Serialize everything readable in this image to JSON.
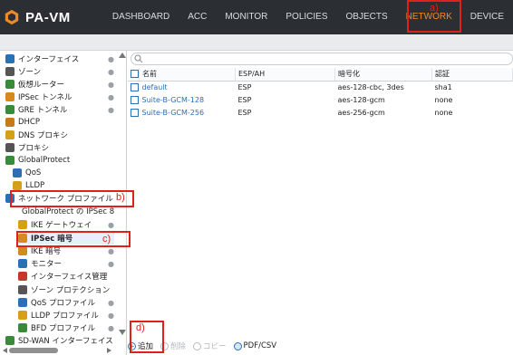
{
  "app": {
    "title": "PA-VM"
  },
  "nav": [
    {
      "label": "DASHBOARD",
      "active": false
    },
    {
      "label": "ACC",
      "active": false
    },
    {
      "label": "MONITOR",
      "active": false
    },
    {
      "label": "POLICIES",
      "active": false
    },
    {
      "label": "OBJECTS",
      "active": false
    },
    {
      "label": "NETWORK",
      "active": true
    },
    {
      "label": "DEVICE",
      "active": false
    }
  ],
  "sidebar": {
    "items": [
      {
        "label": "インターフェイス",
        "icon": "interface-icon"
      },
      {
        "label": "ゾーン",
        "icon": "zone-icon"
      },
      {
        "label": "仮想ルーター",
        "icon": "router-icon"
      },
      {
        "label": "IPSec トンネル",
        "icon": "tunnel-icon"
      },
      {
        "label": "GRE トンネル",
        "icon": "gre-icon"
      },
      {
        "label": "DHCP",
        "icon": "dhcp-icon"
      },
      {
        "label": "DNS プロキシ",
        "icon": "dns-icon"
      },
      {
        "label": "プロキシ",
        "icon": "proxy-icon"
      },
      {
        "label": "GlobalProtect",
        "icon": "globe-icon"
      },
      {
        "label": "QoS",
        "icon": "qos-icon"
      },
      {
        "label": "LLDP",
        "icon": "lldp-icon"
      },
      {
        "label": "ネットワーク プロファイル",
        "icon": "folder-icon"
      },
      {
        "label": "GlobalProtect の IPSec 8",
        "icon": "lock-icon"
      },
      {
        "label": "IKE ゲートウェイ",
        "icon": "gateway-icon"
      },
      {
        "label": "IPSec 暗号",
        "icon": "lock-icon"
      },
      {
        "label": "IKE 暗号",
        "icon": "lock-icon"
      },
      {
        "label": "モニター",
        "icon": "monitor-icon"
      },
      {
        "label": "インターフェイス管理",
        "icon": "mgmt-icon"
      },
      {
        "label": "ゾーン プロテクション",
        "icon": "protection-icon"
      },
      {
        "label": "QoS プロファイル",
        "icon": "qos-icon"
      },
      {
        "label": "LLDP プロファイル",
        "icon": "lldp-icon"
      },
      {
        "label": "BFD プロファイル",
        "icon": "bfd-icon"
      },
      {
        "label": "SD-WAN インターフェイス",
        "icon": "sdwan-icon"
      }
    ]
  },
  "table": {
    "columns": [
      "名前",
      "ESP/AH",
      "暗号化",
      "認証"
    ],
    "rows": [
      [
        "default",
        "ESP",
        "aes-128-cbc, 3des",
        "sha1"
      ],
      [
        "Suite-B-GCM-128",
        "ESP",
        "aes-128-gcm",
        "none"
      ],
      [
        "Suite-B-GCM-256",
        "ESP",
        "aes-256-gcm",
        "none"
      ]
    ]
  },
  "toolbar": {
    "add": "追加",
    "delete": "削除",
    "copy": "コピー",
    "pdf": "PDF/CSV"
  },
  "annotations": {
    "a": "a)",
    "b": "b)",
    "c": "c)",
    "d": "d)"
  },
  "colors": {
    "accent": "#f08a24",
    "annotation": "#e0201b",
    "link": "#2b6fb5"
  }
}
